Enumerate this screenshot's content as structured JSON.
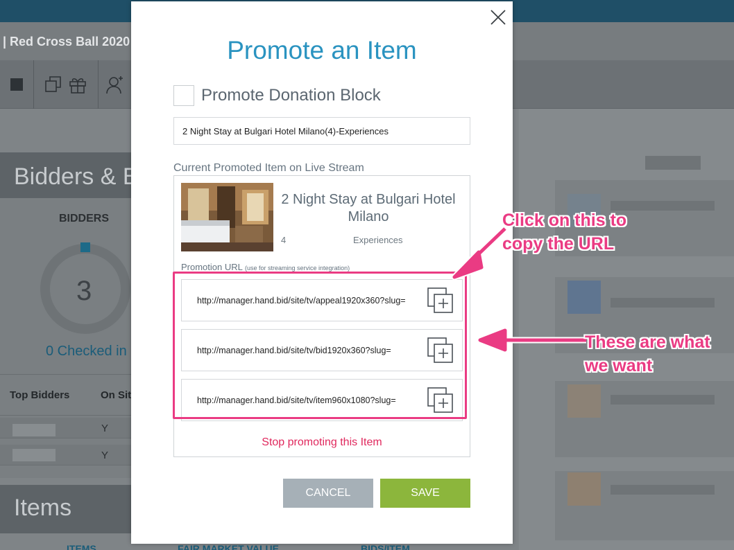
{
  "background": {
    "event_title": "| Red Cross Ball 2020",
    "panel_title": "Bidders & B",
    "bidders_label": "BIDDERS",
    "bidders_count": "3",
    "checked_in": "0 Checked in",
    "table_headers": [
      "Top Bidders",
      "On Sit"
    ],
    "rows": [
      {
        "onsite": "Y"
      },
      {
        "onsite": "Y"
      }
    ],
    "items_title": "Items",
    "bottom_labels": [
      "ITEMS",
      "FAIR MARKET VALUE",
      "BIDS/ITEM"
    ]
  },
  "modal": {
    "title": "Promote an Item",
    "promote_donation_label": "Promote Donation Block",
    "promote_donation_checked": false,
    "selected_item": "2 Night Stay at Bulgari Hotel Milano(4)-Experiences",
    "current_label": "Current Promoted Item on Live Stream",
    "item": {
      "name": "2 Night Stay at Bulgari Hotel Milano",
      "quantity": "4",
      "category": "Experiences"
    },
    "promotion_url_label": "Promotion URL",
    "promotion_url_hint": "(use for streaming service integration)",
    "urls": [
      "http://manager.hand.bid/site/tv/appeal1920x360?slug=",
      "http://manager.hand.bid/site/tv/bid1920x360?slug=",
      "http://manager.hand.bid/site/tv/item960x1080?slug="
    ],
    "stop_label": "Stop promoting this Item",
    "cancel_label": "CANCEL",
    "save_label": "SAVE"
  },
  "annotations": {
    "copy_note_line1": "Click on this to",
    "copy_note_line2": "copy the URL",
    "want_note_line1": "These are what",
    "want_note_line2": "we want"
  },
  "colors": {
    "accent_blue": "#2a93c0",
    "save_green": "#8cb63c",
    "cancel_gray": "#a6b0b7",
    "stop_red": "#e0285d",
    "annotation_pink": "#ea3b83"
  }
}
